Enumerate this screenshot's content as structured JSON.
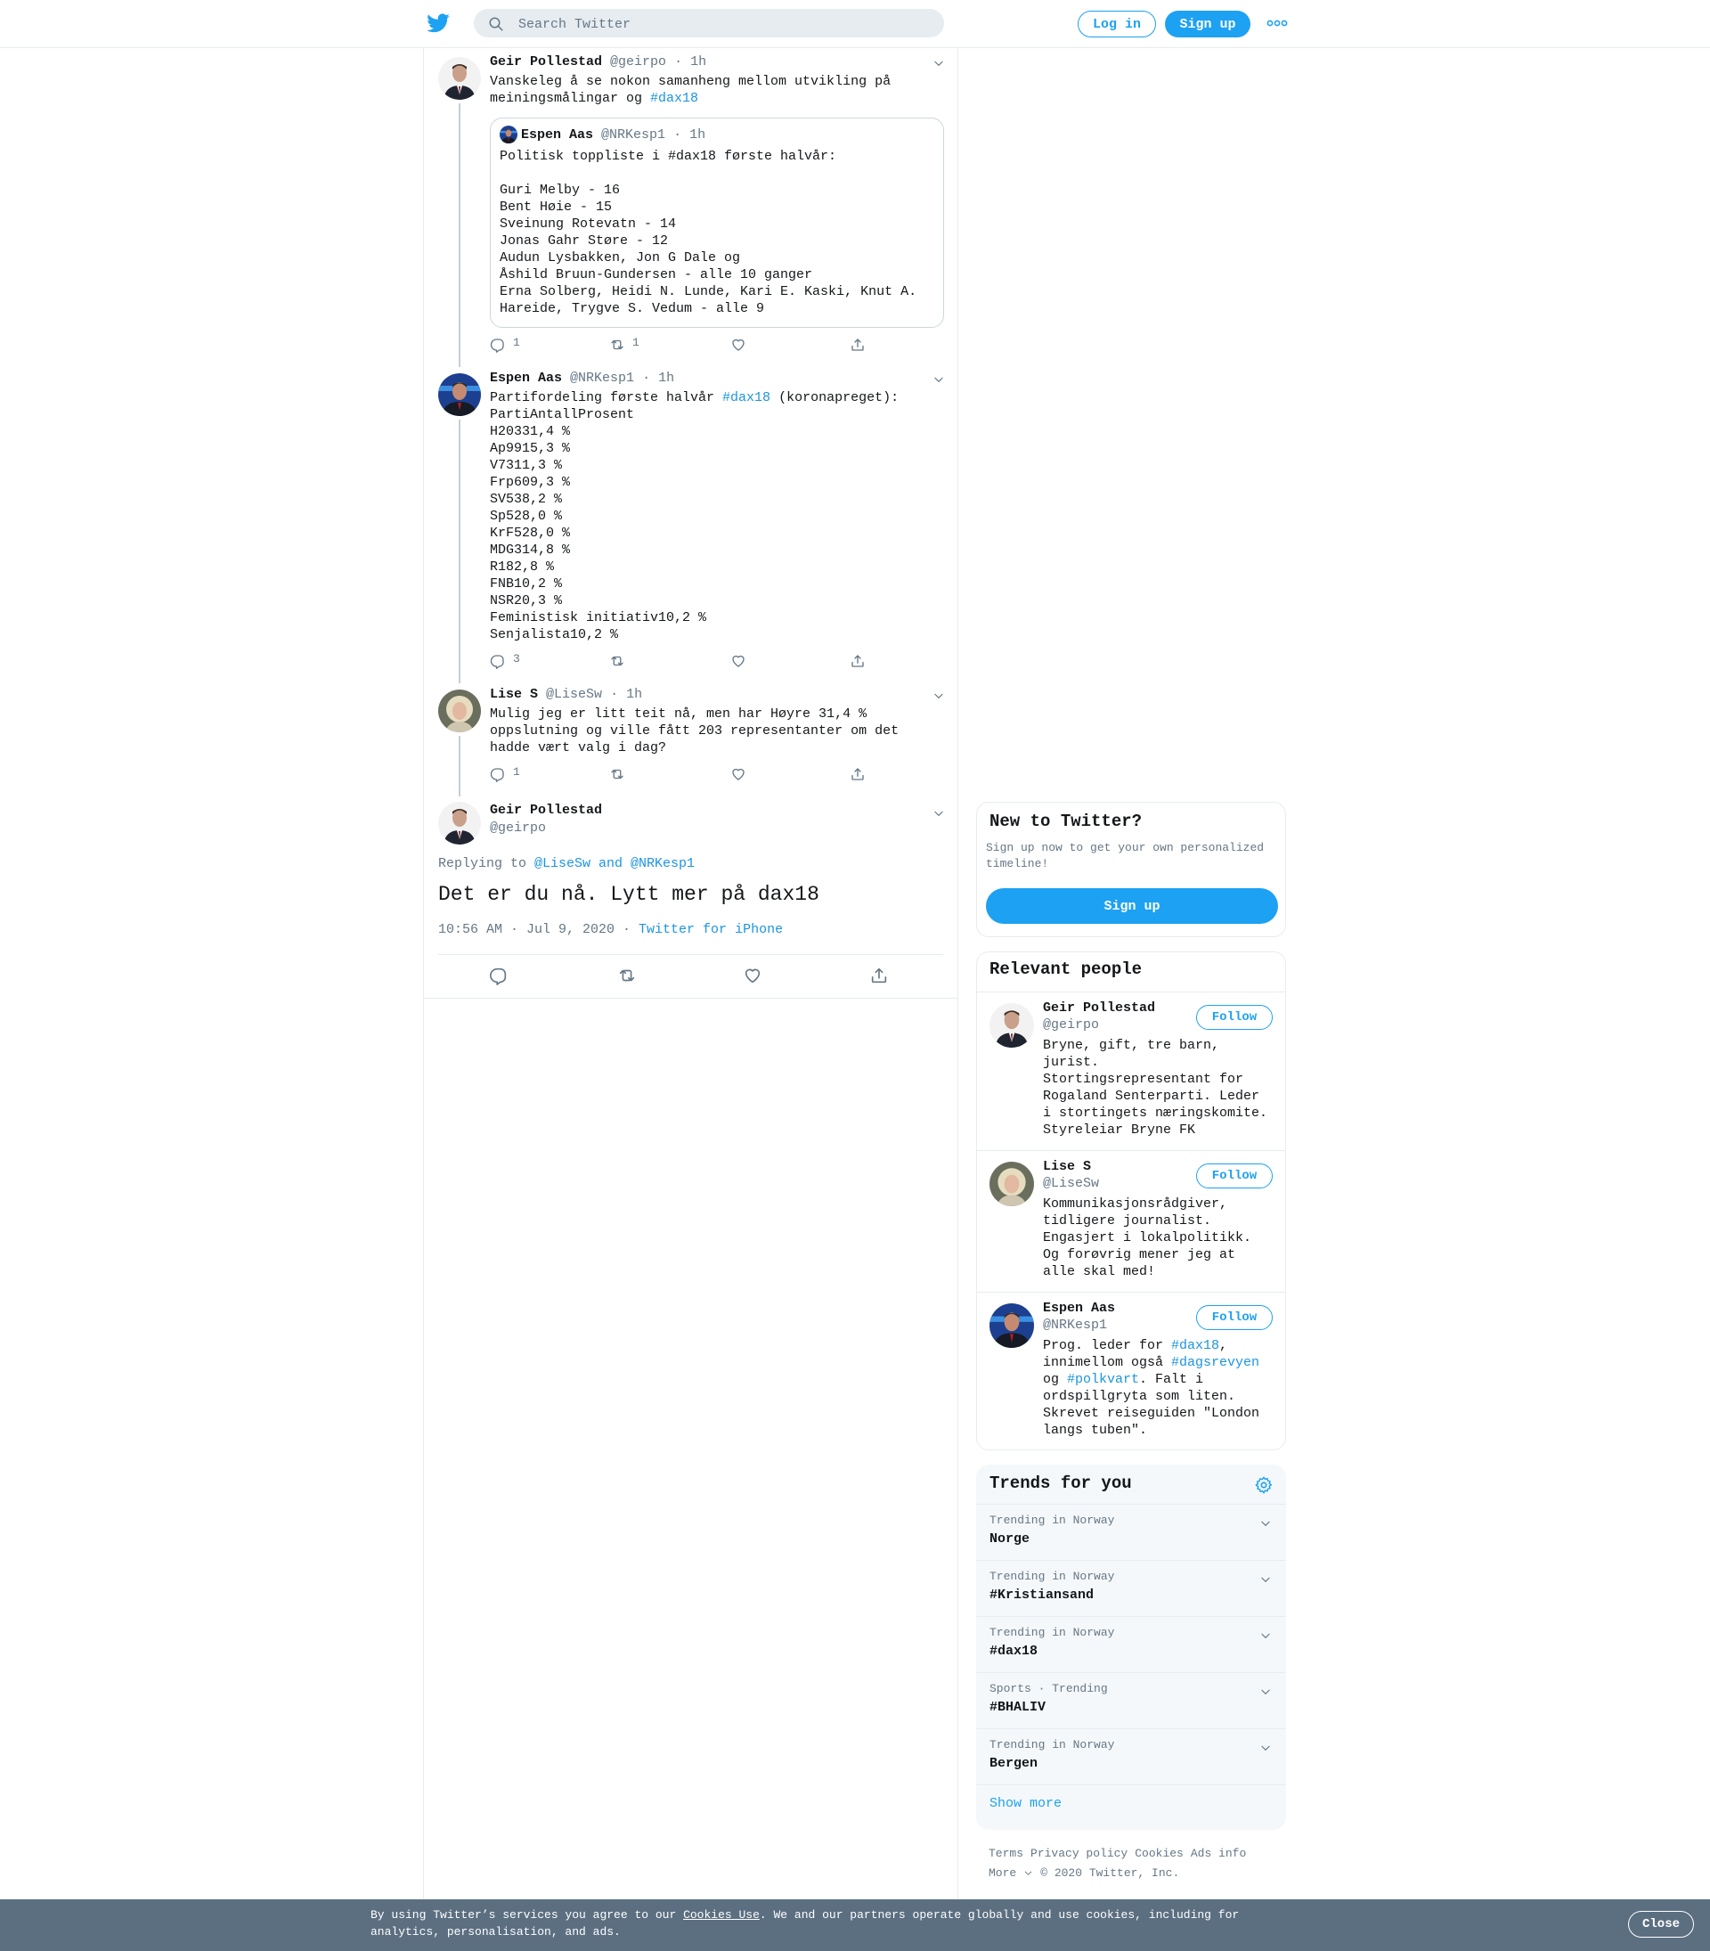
{
  "colors": {
    "brand": "#1da1f2",
    "link": "#1b95e0",
    "muted": "#657786",
    "cookie_bg": "#5c6f81"
  },
  "header": {
    "logo_icon": "twitter-bird-icon",
    "search_placeholder": "Search Twitter",
    "login_label": "Log in",
    "signup_label": "Sign up",
    "more_icon": "more-dots-icon"
  },
  "thread": [
    {
      "name": "Geir Pollestad",
      "handle": "@geirpo",
      "time": "· 1h",
      "text_before": "Vanskeleg å se nokon samanheng mellom utvikling på meiningsmålingar og ",
      "hashtag": "#dax18",
      "quote": {
        "name": "Espen Aas",
        "handle": "@NRKesp1",
        "time": "· 1h",
        "text": "Politisk toppliste i #dax18 første halvår:\n\nGuri Melby - 16\nBent Høie - 15\nSveinung Rotevatn - 14\nJonas Gahr Støre - 12\nAudun Lysbakken, Jon G Dale og\nÅshild Bruun-Gundersen - alle 10 ganger\nErna Solberg, Heidi N. Lunde, Kari E. Kaski, Knut A.\nHareide, Trygve S. Vedum - alle 9"
      },
      "replies": "1",
      "retweets": "1"
    },
    {
      "name": "Espen Aas",
      "handle": "@NRKesp1",
      "time": "· 1h",
      "text_before": "Partifordeling første halvår ",
      "hashtag": "#dax18",
      "text_after": " (koronapreget):\nPartiAntallProsent\nH20331,4 %\nAp9915,3 %\nV7311,3 %\nFrp609,3 %\nSV538,2 %\nSp528,0 %\nKrF528,0 %\nMDG314,8 %\nR182,8 %\nFNB10,2 %\nNSR20,3 %\nFeministisk initiativ10,2 %\nSenjalista10,2 %",
      "replies": "3"
    },
    {
      "name": "Lise S",
      "handle": "@LiseSw",
      "time": "· 1h",
      "text": "Mulig jeg er litt teit nå, men har Høyre 31,4 %\noppslutning og ville fått 203 representanter om det\nhadde vært valg i dag?",
      "replies": "1"
    }
  ],
  "focus": {
    "name": "Geir Pollestad",
    "handle": "@geirpo",
    "replying_prefix": "Replying to ",
    "replying_to": "@LiseSw and @NRKesp1",
    "text": "Det er du nå. Lytt mer på dax18",
    "timestamp": "10:56 AM · Jul 9, 2020 · ",
    "source": "Twitter for iPhone"
  },
  "new_to_twitter": {
    "title": "New to Twitter?",
    "subtitle": "Sign up now to get your own personalized timeline!",
    "button": "Sign up"
  },
  "relevant_people": {
    "title": "Relevant people",
    "follow_label": "Follow",
    "people": [
      {
        "name": "Geir Pollestad",
        "handle": "@geirpo",
        "bio": "Bryne, gift, tre barn,\njurist.\nStortingsrepresentant for\nRogaland Senterparti. Leder\ni stortingets næringskomite.\nStyreleiar Bryne FK"
      },
      {
        "name": "Lise S",
        "handle": "@LiseSw",
        "bio": "Kommunikasjonsrådgiver,\ntidligere journalist.\nEngasjert i lokalpolitikk.\nOg forøvrig mener jeg at\nalle skal med!"
      },
      {
        "name": "Espen Aas",
        "handle": "@NRKesp1",
        "bio_1": "Prog. leder for ",
        "tag_1": "#dax18",
        "bio_2": ",\ninnimellom også ",
        "tag_2": "#dagsrevyen",
        "bio_3": "\nog ",
        "tag_3": "#polkvart",
        "bio_4": ". Falt i\nordspillgryta som liten.\nSkrevet reiseguiden \"London\nlangs tuben\"."
      }
    ]
  },
  "trends": {
    "title": "Trends for you",
    "items": [
      {
        "context": "Trending in Norway",
        "name": "Norge"
      },
      {
        "context": "Trending in Norway",
        "name": "#Kristiansand"
      },
      {
        "context": "Trending in Norway",
        "name": "#dax18"
      },
      {
        "context": "Sports · Trending",
        "name": "#BHALIV"
      },
      {
        "context": "Trending in Norway",
        "name": "Bergen"
      }
    ],
    "show_more": "Show more"
  },
  "footer": {
    "terms": "Terms",
    "privacy": "Privacy policy",
    "cookies": "Cookies",
    "ads": "Ads info",
    "more": "More",
    "copyright": "© 2020 Twitter, Inc."
  },
  "cookie_bar": {
    "text_1": "By using Twitter’s services you agree to our ",
    "link": "Cookies Use",
    "text_2": ". We and our partners operate globally and use cookies, including for analytics, personalisation, and ads.",
    "close": "Close"
  }
}
